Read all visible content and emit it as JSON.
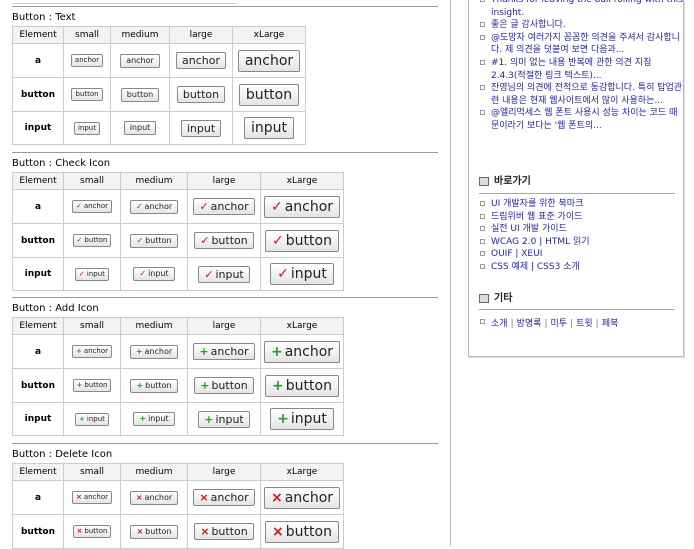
{
  "columns": [
    "Element",
    "small",
    "medium",
    "large",
    "xLarge"
  ],
  "sections": [
    {
      "title": "Button : Text",
      "icon": "none",
      "rows": [
        {
          "head": "a",
          "label": "anchor"
        },
        {
          "head": "button",
          "label": "button"
        },
        {
          "head": "input",
          "label": "input"
        }
      ]
    },
    {
      "title": "Button : Check Icon",
      "icon": "check-icon",
      "glyph": "✓",
      "rows": [
        {
          "head": "a",
          "label": "anchor"
        },
        {
          "head": "button",
          "label": "button"
        },
        {
          "head": "input",
          "label": "input"
        }
      ]
    },
    {
      "title": "Button : Add Icon",
      "icon": "plus-icon",
      "glyph": "+",
      "rows": [
        {
          "head": "a",
          "label": "anchor"
        },
        {
          "head": "button",
          "label": "button"
        },
        {
          "head": "input",
          "label": "input"
        }
      ]
    },
    {
      "title": "Button : Delete Icon",
      "icon": "x-icon",
      "glyph": "×",
      "rows": [
        {
          "head": "a",
          "label": "anchor"
        },
        {
          "head": "button",
          "label": "button"
        }
      ]
    }
  ],
  "sidebar": {
    "comments": [
      "Thanks for leaving the ball rolling with this insight.",
      "좋은 글 감사합니다.",
      "@도망자 여러가지 꼼꼼한 의견을 주셔서 감사합니다. 제 의견을 덧붙여 보면 다음과...",
      "#1. 의미 없는 내용 반복에 관한 의견 지침 2.4.3(적절한 링크 텍스트)...",
      "잔영님의 의견에 전적으로 동감합니다. 특히 탑업관련 내용은 현재 웹사이트에서 많이 사용하는...",
      "@엘리먹세스 웹 폰트 사용시 성능 차이는 코드 때문이라기 보다는 '웹 폰트의..."
    ],
    "links_title": "바로가기",
    "links": [
      "UI 개발자를 위한 북마크",
      "드림위버 웹 표준 가이드",
      "실전 UI 개발 가이드",
      "WCAG 2.0 | HTML 읽기",
      "OUIF | XEUI",
      "CSS 예제 | CSS3 소개"
    ],
    "etc_title": "기타",
    "etc_links": [
      "소개",
      "방명록",
      "미투",
      "트윗",
      "페북"
    ]
  }
}
